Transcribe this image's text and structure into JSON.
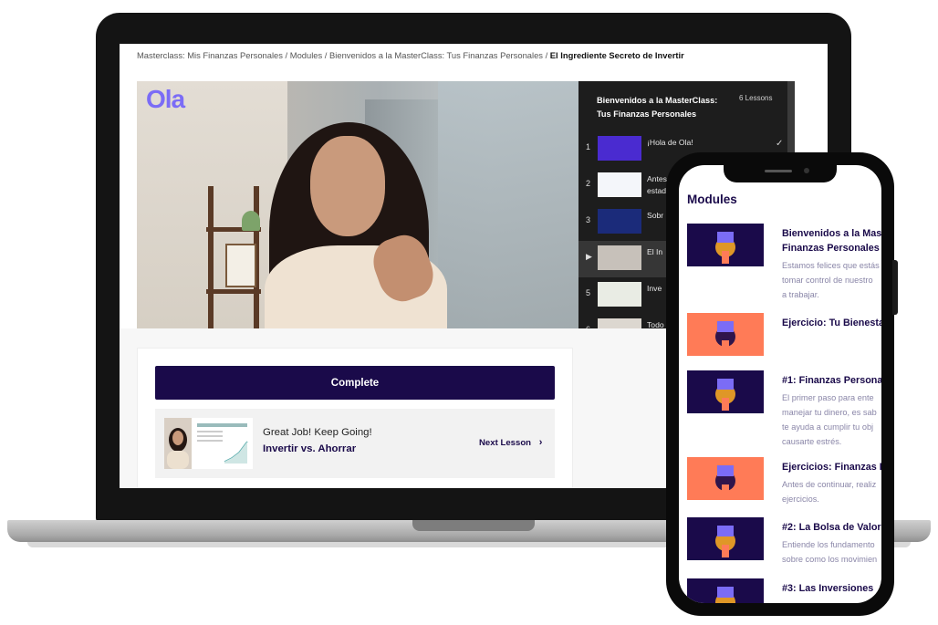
{
  "laptop": {
    "breadcrumb": {
      "path": "Masterclass: Mis Finanzas Personales / Modules / Bienvenidos a la MasterClass: Tus Finanzas Personales / ",
      "current": "El Ingrediente Secreto de Invertir"
    },
    "video": {
      "logo": "Ola"
    },
    "playlist": {
      "title": "Bienvenidos a la MasterClass: Tus Finanzas Personales",
      "count": "6 Lessons",
      "items": [
        {
          "num": "1",
          "title": "¡Hola de Ola!",
          "thumb_color": "#4a2bd0"
        },
        {
          "num": "2",
          "title": "Antes\nestad",
          "thumb_color": "#f4f6fa"
        },
        {
          "num": "3",
          "title": "Sobr",
          "thumb_color": "#1b2b7a"
        },
        {
          "num": "▶",
          "title": "El In",
          "thumb_color": "#c7c1ba"
        },
        {
          "num": "5",
          "title": "Inve",
          "thumb_color": "#e9ece4"
        },
        {
          "num": "6",
          "title": "Todo",
          "thumb_color": "#dcd7d0"
        }
      ]
    },
    "lesson": {
      "complete_label": "Complete",
      "next_message": "Great Job! Keep Going!",
      "next_title": "Invertir vs. Ahorrar",
      "next_link": "Next Lesson"
    }
  },
  "phone": {
    "heading": "Modules",
    "modules": [
      {
        "title": "Bienvenidos a la Mas\nFinanzas Personales",
        "desc": "Estamos felices que estás\ntomar control de nuestro\na trabajar.",
        "bg": "#1a0a4a"
      },
      {
        "title": "Ejercicio: Tu Bienesta",
        "desc": "",
        "bg": "#ff7b57"
      },
      {
        "title": "#1: Finanzas Persona",
        "desc": "El primer paso para ente\nmanejar tu dinero, es sab\nte ayuda a cumplir tu obj\ncausarte estrés.",
        "bg": "#1a0a4a"
      },
      {
        "title": "Ejercicios: Finanzas P",
        "desc": "Antes de continuar, realiz\nejercicios.",
        "bg": "#ff7b57"
      },
      {
        "title": "#2: La Bolsa de Valor",
        "desc": "Entiende los fundamento\nsobre como los movimien",
        "bg": "#1a0a4a"
      },
      {
        "title": "#3: Las Inversiones",
        "desc": "",
        "bg": "#1a0a4a"
      }
    ]
  }
}
